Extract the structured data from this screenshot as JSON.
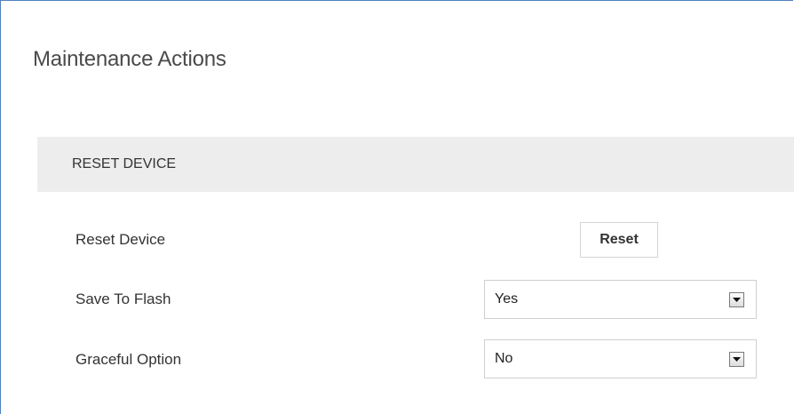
{
  "page": {
    "title": "Maintenance Actions"
  },
  "section": {
    "title": "RESET DEVICE"
  },
  "rows": {
    "reset_device": {
      "label": "Reset Device",
      "button_label": "Reset"
    },
    "save_to_flash": {
      "label": "Save To Flash",
      "value": "Yes"
    },
    "graceful_option": {
      "label": "Graceful Option",
      "value": "No"
    }
  },
  "icons": {
    "dropdown": "chevron-down-icon"
  },
  "colors": {
    "frame_border": "#4f81bd",
    "section_header_bg": "#ededed",
    "title_text": "#4a4a4a"
  }
}
